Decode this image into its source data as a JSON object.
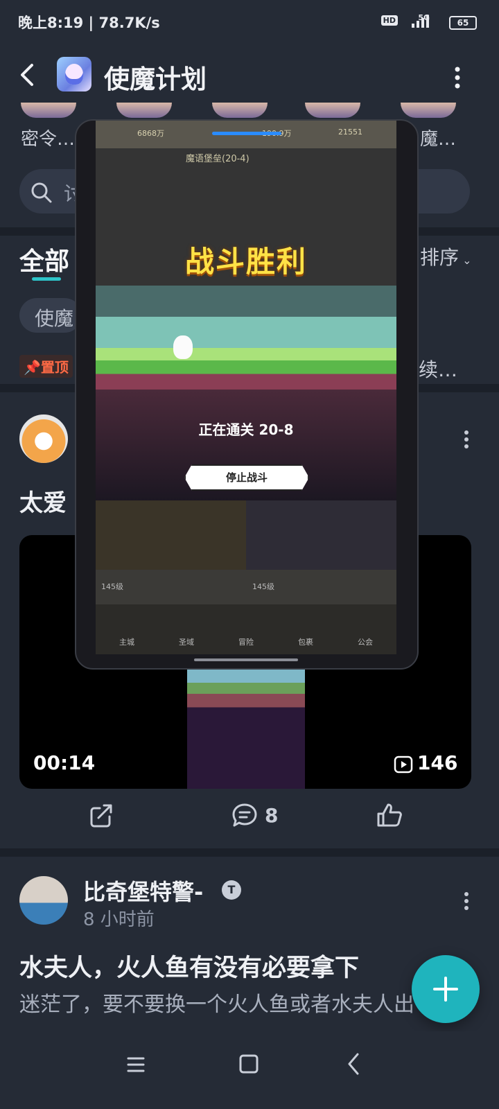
{
  "status_bar": {
    "time_speed": "晚上8:19 | 78.7K/s",
    "hd": "HD",
    "network": "5G",
    "battery": "65"
  },
  "header": {
    "title": "使魔计划"
  },
  "feed": {
    "sub_left": "密令…",
    "sub_right": "魔…",
    "search_placeholder": "讨",
    "tab_all": "全部",
    "sort_label": "排序",
    "chip": "使魔",
    "pinned_label": "置顶",
    "pinned_right": "续…",
    "post1": {
      "title": "太爱",
      "video_duration": "00:14",
      "video_plays": "146",
      "comment_count": "8"
    },
    "post2": {
      "author": "比奇堡特警-",
      "badge": "T",
      "time": "8 小时前",
      "title": "水夫人，火人鱼有没有必要拿下",
      "body": "迷茫了，要不要换一个火人鱼或者水夫人出"
    }
  },
  "floating_window": {
    "stats": [
      "6868万",
      "190.9万",
      "21551"
    ],
    "stage": "魔语堡垒(20-4)",
    "victory": "战斗胜利",
    "progress": "正在通关 20-8",
    "stop_button": "停止战斗",
    "levels": [
      "145级",
      "145级"
    ],
    "nav": [
      "主城",
      "圣域",
      "冒险",
      "包裹",
      "公会"
    ]
  }
}
